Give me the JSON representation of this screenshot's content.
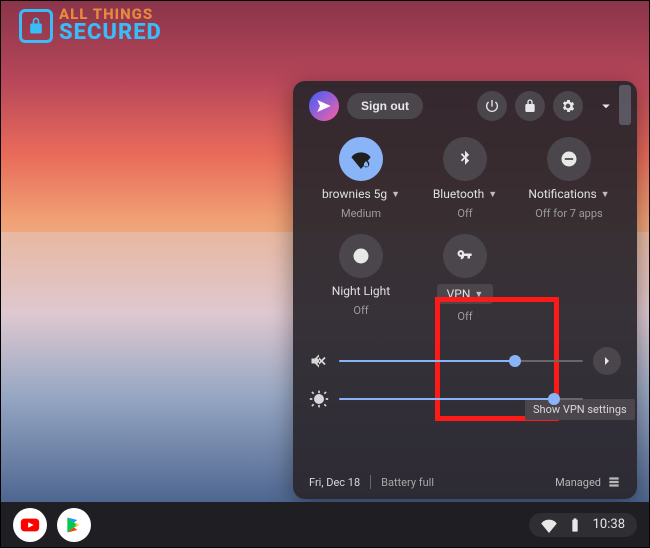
{
  "logo": {
    "top": "ALL THINGS",
    "bottom": "SECURED"
  },
  "header": {
    "sign_out": "Sign out"
  },
  "tiles": {
    "wifi": {
      "label": "brownies 5g",
      "sub": "Medium"
    },
    "bluetooth": {
      "label": "Bluetooth",
      "sub": "Off"
    },
    "notifications": {
      "label": "Notifications",
      "sub": "Off for 7 apps"
    },
    "nightlight": {
      "label": "Night Light",
      "sub": "Off"
    },
    "vpn": {
      "label": "VPN",
      "sub": "Off"
    }
  },
  "tooltip": "Show VPN settings",
  "sliders": {
    "volume_pct": 72,
    "brightness_pct": 88
  },
  "footer": {
    "date": "Fri, Dec 18",
    "battery": "Battery full",
    "managed": "Managed"
  },
  "shelf": {
    "clock": "10:38"
  }
}
